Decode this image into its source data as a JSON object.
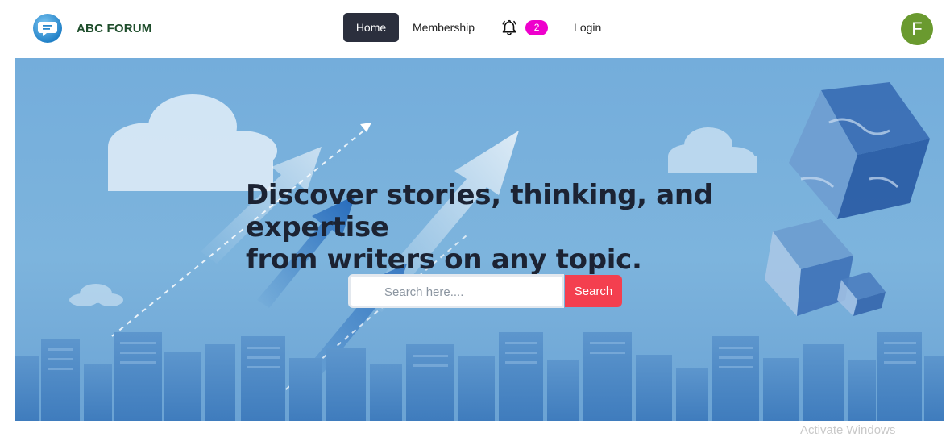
{
  "brand": {
    "name": "ABC FORUM",
    "logo_icon": "speech-bubble-icon"
  },
  "nav": {
    "home_label": "Home",
    "membership_label": "Membership",
    "notification_icon": "bell-icon",
    "notification_count": "2",
    "login_label": "Login"
  },
  "user": {
    "avatar_initial": "F"
  },
  "hero": {
    "headline_line1": "Discover stories, thinking, and expertise",
    "headline_line2": "from writers on any topic.",
    "search_placeholder": "Search here....",
    "search_button_label": "Search"
  },
  "watermark": "Activate Windows",
  "colors": {
    "nav_active_bg": "#2b2f3d",
    "badge_bg": "#ee00cc",
    "avatar_bg": "#6a9a2f",
    "search_button_bg": "#f43f4f",
    "hero_sky": "#7db4dd",
    "headline_text": "#1c2333"
  }
}
